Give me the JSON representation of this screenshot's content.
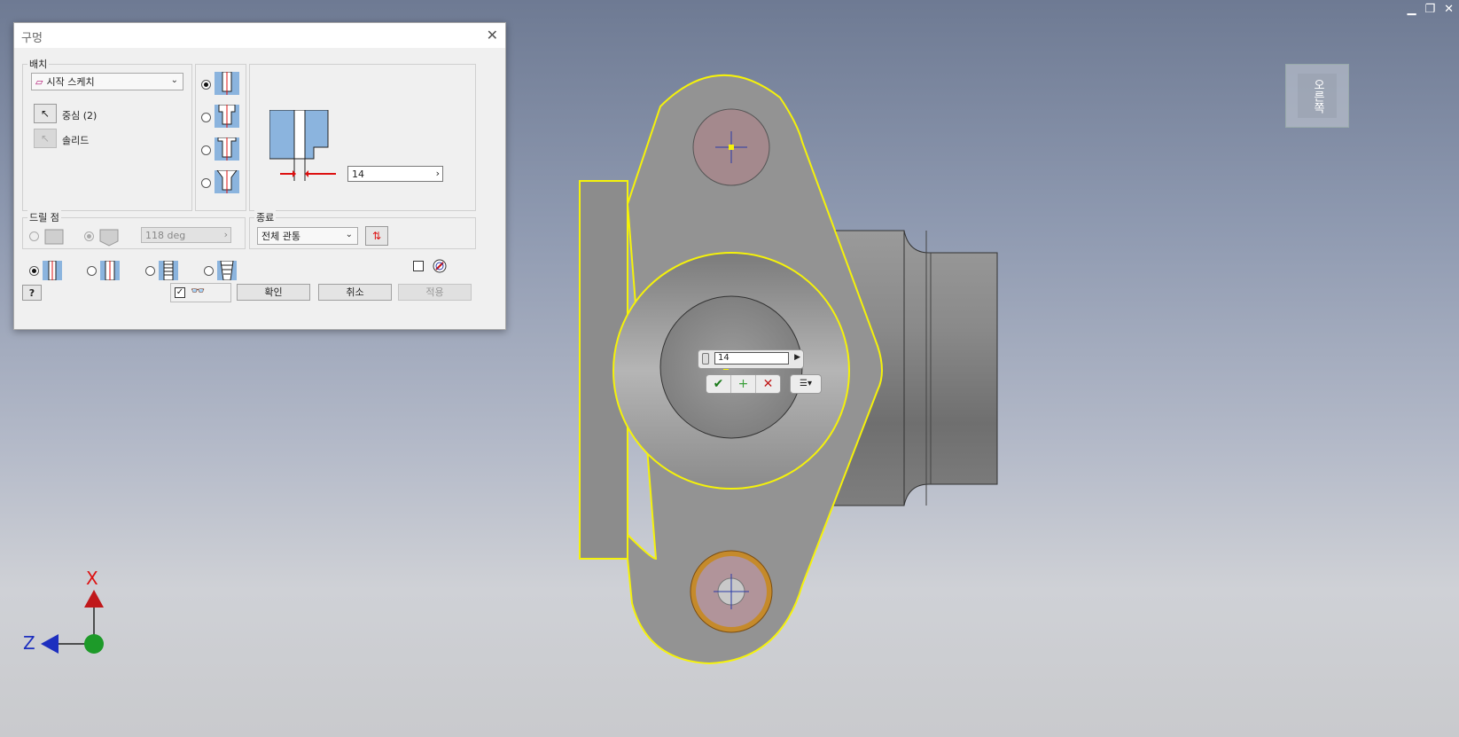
{
  "window": {
    "min_icon": "minimize-icon",
    "restore_icon": "restore-icon",
    "close_icon": "close-icon"
  },
  "dialog": {
    "title": "구멍",
    "placement": {
      "label": "배치",
      "combo_value": "시작 스케치",
      "center_label": "중심 (2)",
      "solid_label": "솔리드"
    },
    "hole_type_selected": 0,
    "diameter_value": "14",
    "drill_point": {
      "label": "드릴 점",
      "angle_value": "118 deg"
    },
    "termination": {
      "label": "종료",
      "combo_value": "전체 관통"
    },
    "buttons": {
      "ok": "확인",
      "cancel": "취소",
      "apply": "적용"
    }
  },
  "canvas": {
    "mini_value": "14",
    "viewcube_face": "오른쪽",
    "axis": {
      "x": "X",
      "z": "Z"
    },
    "colors": {
      "edge_highlight": "#f5f20a",
      "part": "#8e8e8e"
    }
  }
}
